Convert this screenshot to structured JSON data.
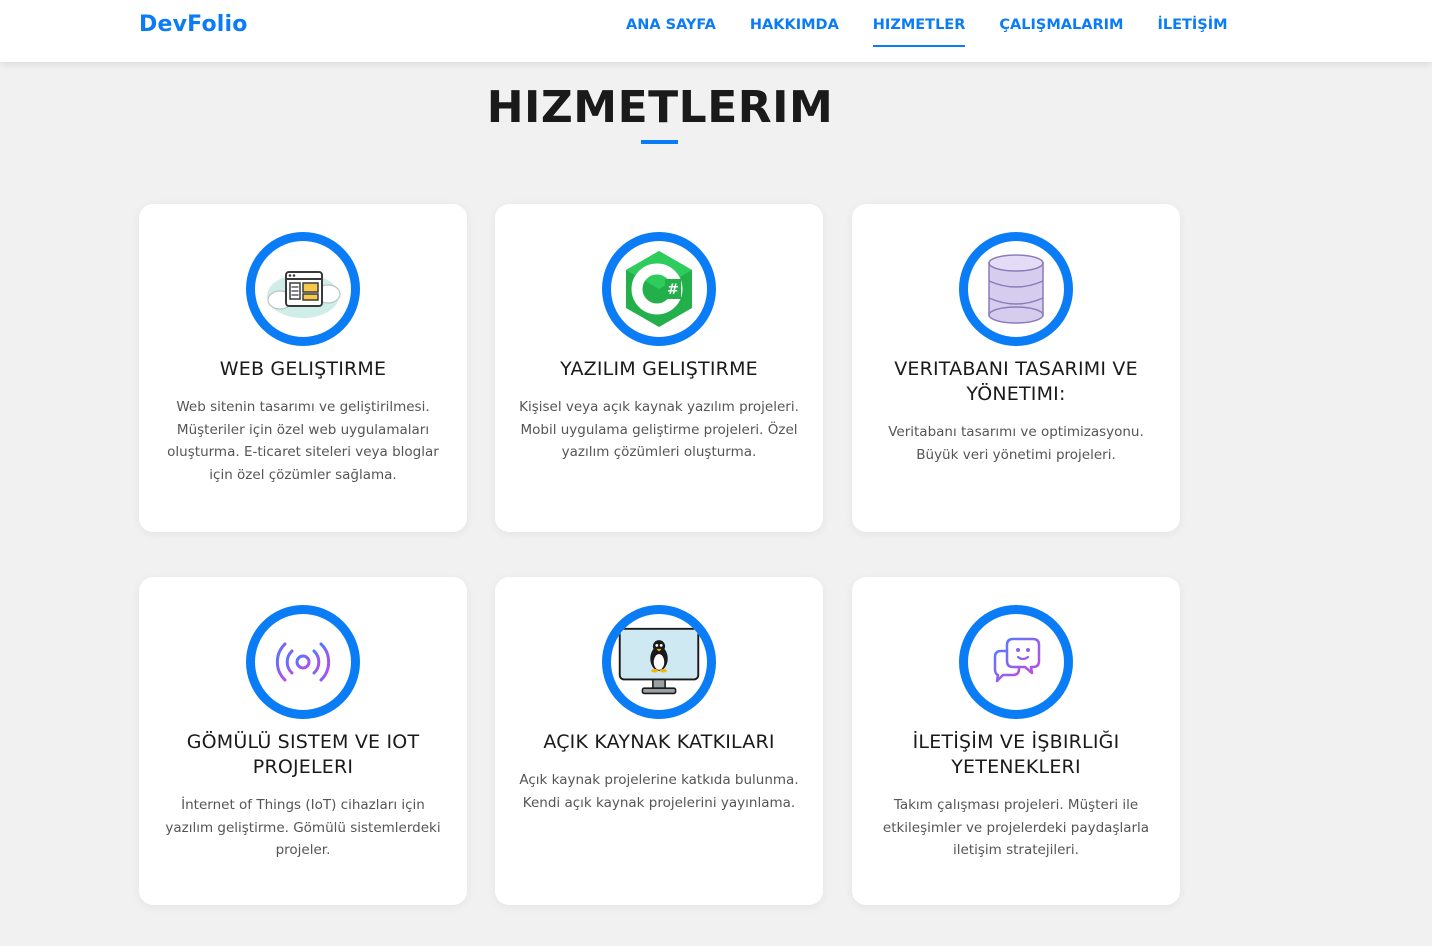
{
  "brand": "DevFolio",
  "nav": {
    "items": [
      {
        "label": "ANA SAYFA"
      },
      {
        "label": "HAKKIMDA"
      },
      {
        "label": "HIZMETLER"
      },
      {
        "label": "ÇALIŞMALARIM"
      },
      {
        "label": "İLETİŞİM"
      }
    ],
    "active": "HIZMETLER"
  },
  "section": {
    "title": "HIZMETLERIM"
  },
  "services": [
    {
      "title": "WEB GELIŞTIRME",
      "description": "Web sitenin tasarımı ve geliştirilmesi. Müşteriler için özel web uygulamaları oluşturma. E-ticaret siteleri veya bloglar için özel çözümler sağlama.",
      "icon": "web-browser-icon"
    },
    {
      "title": "YAZILIM GELIŞTIRME",
      "description": "Kişisel veya açık kaynak yazılım projeleri. Mobil uygulama geliştirme projeleri. Özel yazılım çözümleri oluşturma.",
      "icon": "csharp-icon"
    },
    {
      "title": "VERITABANI TASARIMI VE YÖNETIMI:",
      "description": "Veritabanı tasarımı ve optimizasyonu. Büyük veri yönetimi projeleri.",
      "icon": "database-icon"
    },
    {
      "title": "GÖMÜLÜ SISTEM VE IOT PROJELERI",
      "description": "İnternet of Things (IoT) cihazları için yazılım geliştirme. Gömülü sistemlerdeki projeler.",
      "icon": "iot-signal-icon"
    },
    {
      "title": "AÇIK KAYNAK KATKILARI",
      "description": "Açık kaynak projelerine katkıda bulunma. Kendi açık kaynak projelerini yayınlama.",
      "icon": "linux-monitor-icon"
    },
    {
      "title": "İLETİŞİM VE İŞBIRLIĞI YETENEKLERI",
      "description": "Takım çalışması projeleri. Müşteri ile etkileşimler ve projelerdeki paydaşlarla iletişim stratejileri.",
      "icon": "chat-bubbles-icon"
    }
  ],
  "colors": {
    "accent": "#0a7cf5",
    "background": "#f1f1f1",
    "card": "#ffffff"
  }
}
